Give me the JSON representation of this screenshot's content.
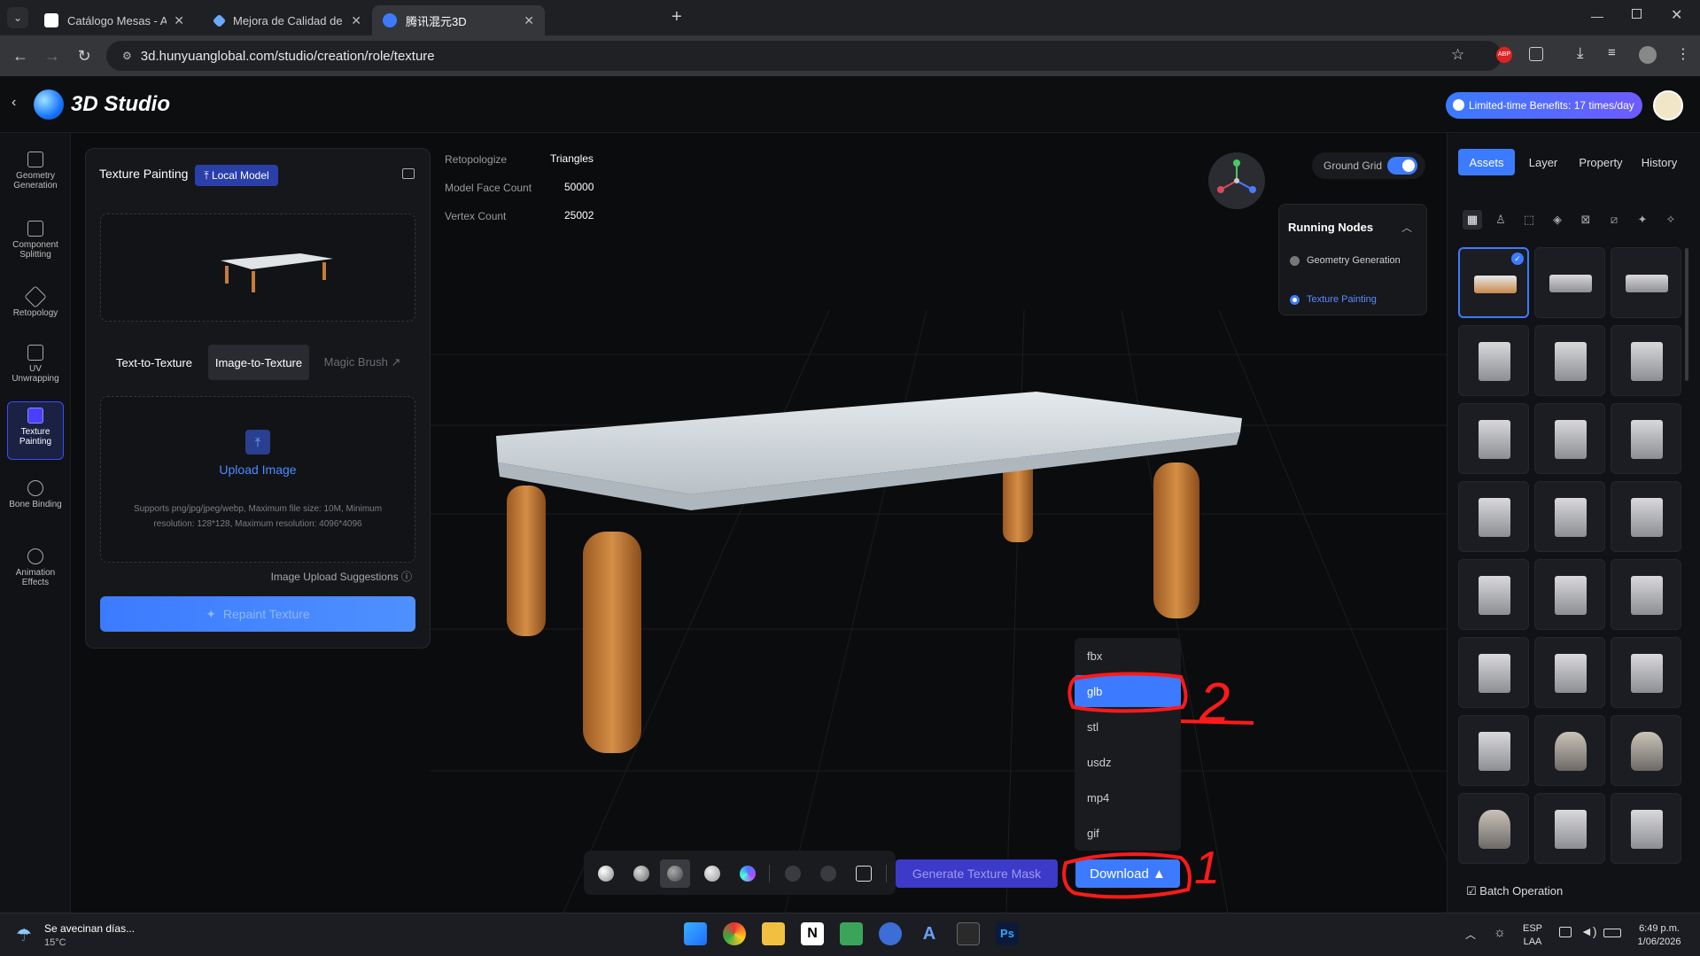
{
  "browser": {
    "tabs": [
      {
        "title": "Catálogo Mesas - Alcira Guevara",
        "icon_color": "#ffffff"
      },
      {
        "title": "Mejora de Calidad de Imagen con",
        "icon_color": "#6aa9ff"
      },
      {
        "title": "腾讯混元3D",
        "icon_color": "#3c7bff"
      }
    ],
    "url": "3d.hunyuanglobal.com/studio/creation/role/texture"
  },
  "header": {
    "brand": "3D Studio",
    "benefit": "Limited-time Benefits: 17 times/day"
  },
  "rail": [
    {
      "label": "Geometry Generation",
      "icon": "geometry-icon"
    },
    {
      "label": "Component Splitting",
      "icon": "component-icon"
    },
    {
      "label": "Retopology",
      "icon": "retopology-icon"
    },
    {
      "label": "UV Unwrapping",
      "icon": "uv-icon"
    },
    {
      "label": "Texture Painting",
      "icon": "texture-icon",
      "active": true
    },
    {
      "label": "Bone Binding",
      "icon": "bone-icon"
    },
    {
      "label": "Animation Effects",
      "icon": "animation-icon"
    }
  ],
  "panel": {
    "title": "Texture Painting",
    "local_model": "Local Model",
    "modes": [
      "Text-to-Texture",
      "Image-to-Texture",
      "Magic Brush ↗"
    ],
    "active_mode": "Image-to-Texture",
    "upload_label": "Upload Image",
    "upload_hint": "Supports png/jpg/jpeg/webp, Maximum file size: 10M, Minimum resolution: 128*128, Maximum resolution: 4096*4096",
    "suggestions": "Image Upload Suggestions ⓘ",
    "repaint": "Repaint Texture"
  },
  "model_info": {
    "retopologize_label": "Retopologize",
    "retopologize_value": "Triangles",
    "face_label": "Model Face Count",
    "face_value": "50000",
    "vertex_label": "Vertex Count",
    "vertex_value": "25002"
  },
  "viewport": {
    "ground_grid": "Ground Grid",
    "ground_grid_on": true
  },
  "running_nodes": {
    "title": "Running Nodes",
    "items": [
      {
        "label": "Geometry Generation",
        "active": false
      },
      {
        "label": "Texture Painting",
        "active": true
      }
    ]
  },
  "right_panel": {
    "tabs": [
      "Assets",
      "Layer",
      "Property",
      "History"
    ],
    "active_tab": "Assets",
    "filter_icons": [
      "grid-icon",
      "geometry-icon",
      "component-icon",
      "retopology-icon",
      "uv-icon",
      "texture-icon",
      "bone-icon",
      "animation-icon"
    ],
    "asset_count": 24,
    "batch": "Batch Operation"
  },
  "toolbar": {
    "generate_mask": "Generate Texture Mask",
    "download": "Download ▲"
  },
  "download_menu": {
    "options": [
      "fbx",
      "glb",
      "stl",
      "usdz",
      "mp4",
      "gif"
    ],
    "selected": "glb"
  },
  "annotations": {
    "one": "1",
    "two": "2"
  },
  "taskbar": {
    "weather_title": "Se avecinan días...",
    "weather_temp": "15°C",
    "lang": "ESP",
    "lang2": "LAA",
    "time": "6:49 p.m.",
    "date": "1/06/2026"
  }
}
